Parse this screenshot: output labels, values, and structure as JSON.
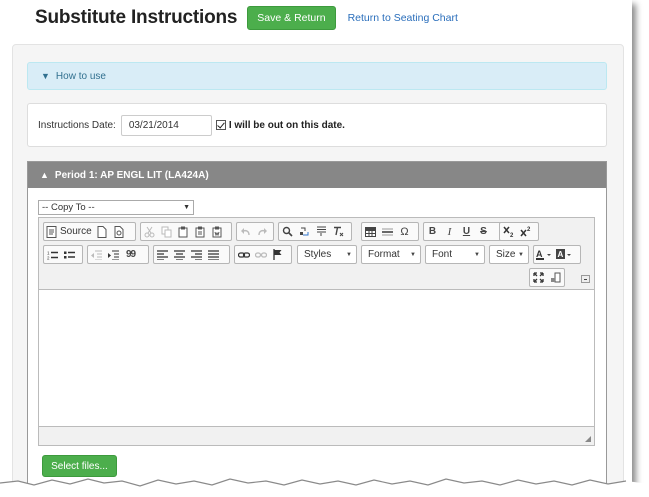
{
  "header": {
    "title": "Substitute Instructions",
    "save_return_label": "Save & Return",
    "seating_link": "Return to Seating Chart"
  },
  "how_to_use": {
    "label": "How to use"
  },
  "instructions_date": {
    "label": "Instructions Date:",
    "value": "03/21/2014",
    "out_checkbox_checked": true,
    "out_checkbox_label": "I will be out on this date."
  },
  "period": {
    "title": "Period 1: AP ENGL LIT (LA424A)",
    "copy_to": {
      "selected": "-- Copy To --"
    },
    "editor": {
      "source_label": "Source",
      "styles_label": "Styles",
      "format_label": "Format",
      "font_label": "Font",
      "size_label": "Size",
      "bold_glyph": "B",
      "italic_glyph": "I",
      "underline_glyph": "U",
      "strike_glyph": "S",
      "omega_glyph": "Ω",
      "blockquote_glyph": "99",
      "content": ""
    },
    "select_files_label": "Select files..."
  },
  "colors": {
    "green_button": "#4cae4c",
    "link": "#2a6ebb",
    "info_bg": "#d9edf7",
    "period_header": "#878787"
  }
}
